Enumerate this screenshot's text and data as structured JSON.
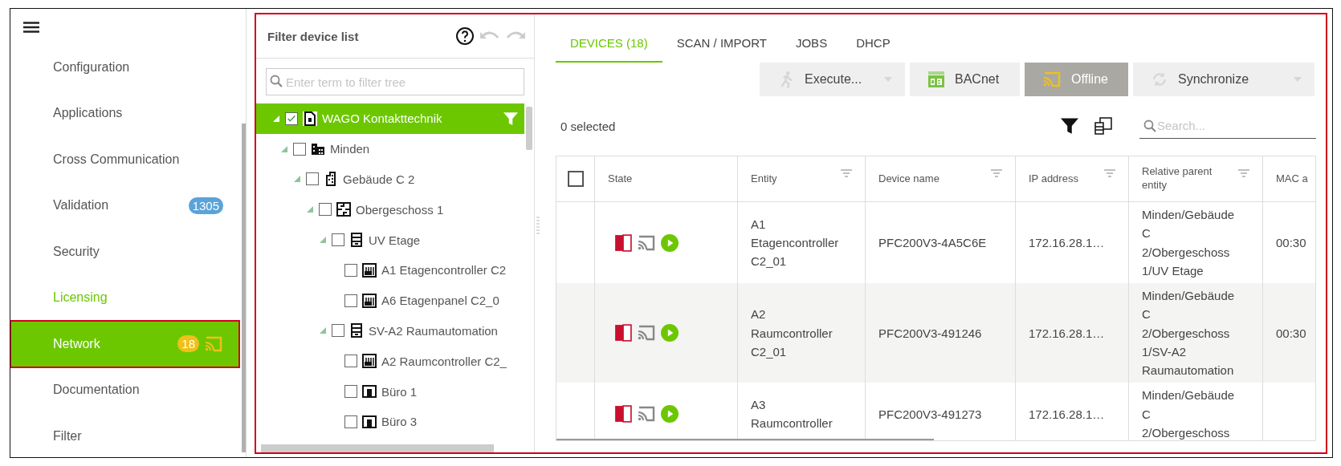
{
  "sidebar": {
    "items": [
      {
        "label": "Configuration",
        "selected": false,
        "hovered": false,
        "highlighted": false
      },
      {
        "label": "Applications",
        "selected": false,
        "hovered": false,
        "highlighted": false
      },
      {
        "label": "Cross Communication",
        "selected": false,
        "hovered": false,
        "highlighted": false
      },
      {
        "label": "Validation",
        "selected": false,
        "hovered": false,
        "highlighted": false,
        "badge": {
          "text": "1305",
          "color": "#5ba3d9"
        }
      },
      {
        "label": "Security",
        "selected": false,
        "hovered": false,
        "highlighted": false
      },
      {
        "label": "Licensing",
        "selected": false,
        "hovered": true,
        "highlighted": false
      },
      {
        "label": "Network",
        "selected": true,
        "hovered": false,
        "highlighted": true,
        "badge": {
          "text": "18",
          "color": "#f0c01a"
        },
        "offline": true
      },
      {
        "label": "Documentation",
        "selected": false,
        "hovered": false,
        "highlighted": false
      },
      {
        "label": "Filter",
        "selected": false,
        "hovered": false,
        "highlighted": false
      }
    ]
  },
  "main": {
    "highlighted": true
  },
  "tree": {
    "title": "Filter device list",
    "search": {
      "placeholder": "Enter term to filter tree"
    },
    "nodes": [
      {
        "label": "WAGO Kontakttechnik",
        "kind": "company",
        "checked": true,
        "selected": true,
        "expanded": true,
        "children": [
          {
            "label": "Minden",
            "kind": "city",
            "checked": false,
            "selected": false,
            "expanded": true,
            "children": [
              {
                "label": "Gebäude C 2",
                "kind": "building",
                "checked": false,
                "selected": false,
                "expanded": true,
                "children": [
                  {
                    "label": "Obergeschoss 1",
                    "kind": "floor",
                    "checked": false,
                    "selected": false,
                    "expanded": true,
                    "children": [
                      {
                        "label": "UV Etage",
                        "kind": "cabinet",
                        "checked": false,
                        "selected": false,
                        "expanded": true,
                        "children": [
                          {
                            "label": "A1 Etagencontroller C2",
                            "kind": "controller",
                            "checked": false,
                            "selected": false
                          },
                          {
                            "label": "A6 Etagenpanel C2_0",
                            "kind": "controller",
                            "checked": false,
                            "selected": false
                          }
                        ]
                      },
                      {
                        "label": "SV-A2 Raumautomation",
                        "kind": "cabinet",
                        "checked": false,
                        "selected": false,
                        "expanded": true,
                        "children": [
                          {
                            "label": "A2 Raumcontroller C2_",
                            "kind": "controller",
                            "checked": false,
                            "selected": false
                          },
                          {
                            "label": "Büro 1",
                            "kind": "room",
                            "checked": false,
                            "selected": false
                          },
                          {
                            "label": "Büro 3",
                            "kind": "room",
                            "checked": false,
                            "selected": false
                          }
                        ]
                      }
                    ]
                  }
                ]
              }
            ]
          }
        ]
      }
    ]
  },
  "tabs": [
    {
      "label": "DEVICES (18)",
      "selected": true
    },
    {
      "label": "SCAN / IMPORT",
      "selected": false
    },
    {
      "label": "JOBS",
      "selected": false
    },
    {
      "label": "DHCP",
      "selected": false
    }
  ],
  "toolbar": [
    {
      "label": "Execute...",
      "kind": "execute",
      "dropdown": true,
      "disabled": true,
      "pressed": false
    },
    {
      "label": "BACnet",
      "kind": "bacnet",
      "dropdown": false,
      "disabled": false,
      "pressed": false
    },
    {
      "label": "Offline",
      "kind": "offline",
      "dropdown": false,
      "disabled": false,
      "pressed": true
    },
    {
      "label": "Synchronize",
      "kind": "sync",
      "dropdown": true,
      "disabled": true,
      "pressed": false
    }
  ],
  "selection_text": "0 selected",
  "search": {
    "placeholder": "Search..."
  },
  "table": {
    "all_checked": false,
    "columns": [
      {
        "label": "State",
        "filter": false
      },
      {
        "label": "Entity",
        "filter": true
      },
      {
        "label": "Device name",
        "filter": true
      },
      {
        "label": "IP address",
        "filter": true
      },
      {
        "label": "Relative parent entity",
        "filter": true
      },
      {
        "label": "MAC a",
        "filter": false
      }
    ],
    "rows": [
      {
        "entity": "A1 Etagencontroller C2_01",
        "device_name": "PFC200V3-4A5C6E",
        "ip": "172.16.28.1…",
        "parent": "Minden/Gebäude C 2/Obergeschoss 1/UV Etage",
        "mac": "00:30"
      },
      {
        "entity": "A2 Raumcontroller C2_01",
        "device_name": "PFC200V3-491246",
        "ip": "172.16.28.1…",
        "parent": "Minden/Gebäude C 2/Obergeschoss 1/SV-A2 Raumautomation",
        "mac": "00:30"
      },
      {
        "entity": "A3 Raumcontroller",
        "device_name": "PFC200V3-491273",
        "ip": "172.16.28.1…",
        "parent": "Minden/Gebäude C 2/Obergeschoss"
      }
    ]
  }
}
